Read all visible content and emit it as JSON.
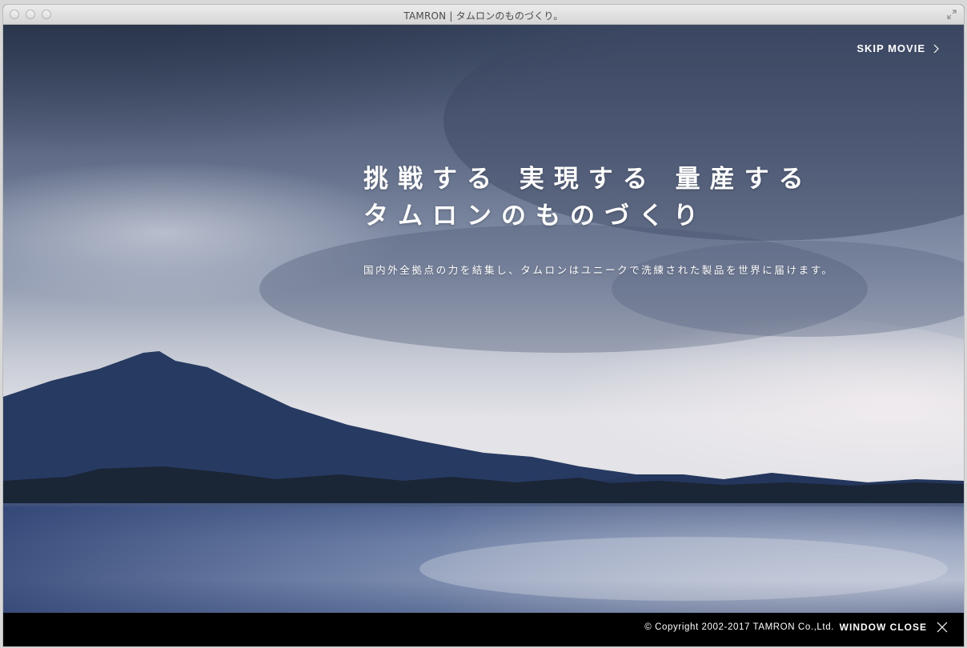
{
  "window": {
    "title": "TAMRON | タムロンのものづくり。"
  },
  "header": {
    "skip_label": "SKIP MOVIE",
    "skip_icon": "chevron-right-icon"
  },
  "hero": {
    "headline_line1": "挑戦する 実現する 量産する",
    "headline_line2": "タムロンのものづくり",
    "subcopy": "国内外全拠点の力を結集し、タムロンはユニークで洗練された製品を世界に届けます。"
  },
  "footer": {
    "copyright": "© Copyright 2002-2017 TAMRON Co.,Ltd.",
    "close_label": "WINDOW CLOSE",
    "close_icon": "close-icon"
  },
  "colors": {
    "footer_bg": "#000000",
    "text": "#ffffff",
    "sky_dark": "#2f3b52",
    "sky_light": "#d9dde4",
    "mountain": "#1e2f4e",
    "water": "#8c97b1"
  }
}
